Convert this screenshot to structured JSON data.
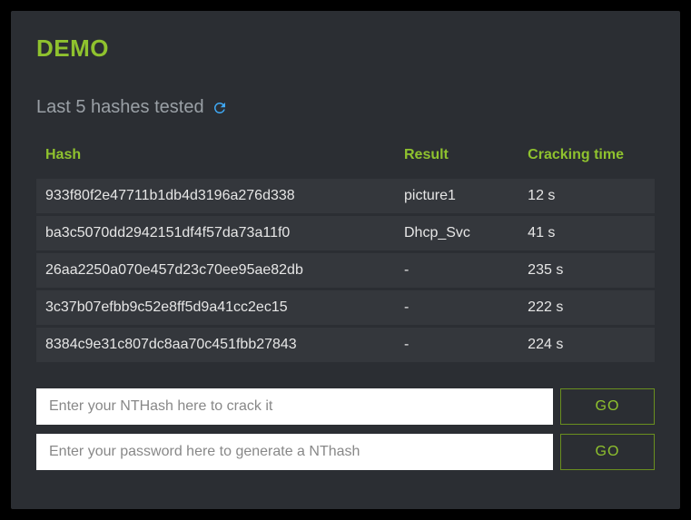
{
  "title": "DEMO",
  "subtitle": "Last 5 hashes tested",
  "icons": {
    "refresh": "refresh-icon"
  },
  "table": {
    "headers": {
      "hash": "Hash",
      "result": "Result",
      "time": "Cracking time"
    },
    "rows": [
      {
        "hash": "933f80f2e47711b1db4d3196a276d338",
        "result": "picture1",
        "time": "12 s"
      },
      {
        "hash": "ba3c5070dd2942151df4f57da73a11f0",
        "result": "Dhcp_Svc",
        "time": "41 s"
      },
      {
        "hash": "26aa2250a070e457d23c70ee95ae82db",
        "result": "-",
        "time": "235 s"
      },
      {
        "hash": "3c37b07efbb9c52e8ff5d9a41cc2ec15",
        "result": "-",
        "time": "222 s"
      },
      {
        "hash": "8384c9e31c807dc8aa70c451fbb27843",
        "result": "-",
        "time": "224 s"
      }
    ]
  },
  "inputs": {
    "crack": {
      "placeholder": "Enter your NTHash here to crack it",
      "button": "GO"
    },
    "generate": {
      "placeholder": "Enter your password here to generate a NThash",
      "button": "GO"
    }
  },
  "colors": {
    "accent": "#8fc22e",
    "panel": "#2b2e33",
    "row": "#34373c",
    "link": "#3fa9f5"
  }
}
